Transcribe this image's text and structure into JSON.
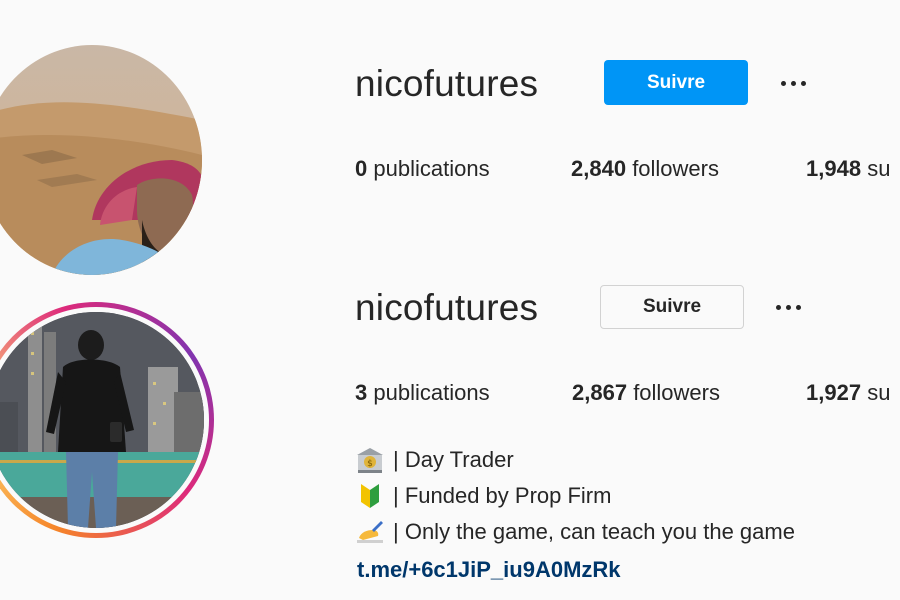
{
  "profile_top": {
    "username": "nicofutures",
    "follow_label": "Suivre",
    "stats": {
      "publications_count": "0",
      "publications_label": "publications",
      "followers_count": "2,840",
      "followers_label": "followers",
      "following_count": "1,948",
      "following_label": "su"
    }
  },
  "profile_bottom": {
    "username": "nicofutures",
    "follow_label": "Suivre",
    "stats": {
      "publications_count": "3",
      "publications_label": "publications",
      "followers_count": "2,867",
      "followers_label": "followers",
      "following_count": "1,927",
      "following_label": "su"
    },
    "bio": [
      {
        "icon": "bank-icon",
        "text": "| Day Trader"
      },
      {
        "icon": "beginner-badge-icon",
        "text": "| Funded by Prop Firm"
      },
      {
        "icon": "writing-hand-icon",
        "text": "| Only the game, can teach you the game"
      }
    ],
    "link": "t.me/+6c1JiP_iu9A0MzRk"
  },
  "colors": {
    "primary_button": "#0095f6",
    "link": "#00376b",
    "story_ring_start": "#f58529",
    "story_ring_end": "#dd2a7b"
  }
}
